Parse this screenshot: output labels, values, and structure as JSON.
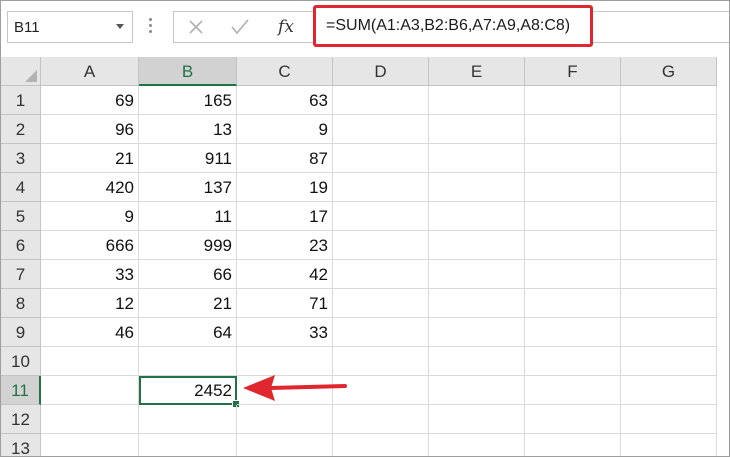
{
  "name_box": {
    "value": "B11"
  },
  "formula_bar": {
    "fx_label": "fx",
    "formula": "=SUM(A1:A3,B2:B6,A7:A9,A8:C8)"
  },
  "sheet": {
    "columns": [
      "A",
      "B",
      "C",
      "D",
      "E",
      "F",
      "G"
    ],
    "rows": [
      "1",
      "2",
      "3",
      "4",
      "5",
      "6",
      "7",
      "8",
      "9",
      "10",
      "11",
      "12",
      "13"
    ],
    "cells": {
      "A": [
        "69",
        "96",
        "21",
        "420",
        "9",
        "666",
        "33",
        "12",
        "46",
        "",
        "",
        "",
        ""
      ],
      "B": [
        "165",
        "13",
        "911",
        "137",
        "11",
        "999",
        "66",
        "21",
        "64",
        "",
        "2452",
        "",
        ""
      ],
      "C": [
        "63",
        "9",
        "87",
        "19",
        "17",
        "23",
        "42",
        "71",
        "33",
        "",
        "",
        "",
        ""
      ]
    },
    "selected_cell": "B11",
    "selected_column": "B",
    "selected_row": "11"
  },
  "colors": {
    "highlight_box": "#e0262e",
    "arrow": "#e0262e",
    "selection": "#217346"
  },
  "icons": {
    "cancel": "close-icon",
    "enter": "checkmark-icon",
    "function": "fx-icon",
    "name_box_dropdown": "chevron-down-icon",
    "annotation": "arrow-left-icon"
  }
}
